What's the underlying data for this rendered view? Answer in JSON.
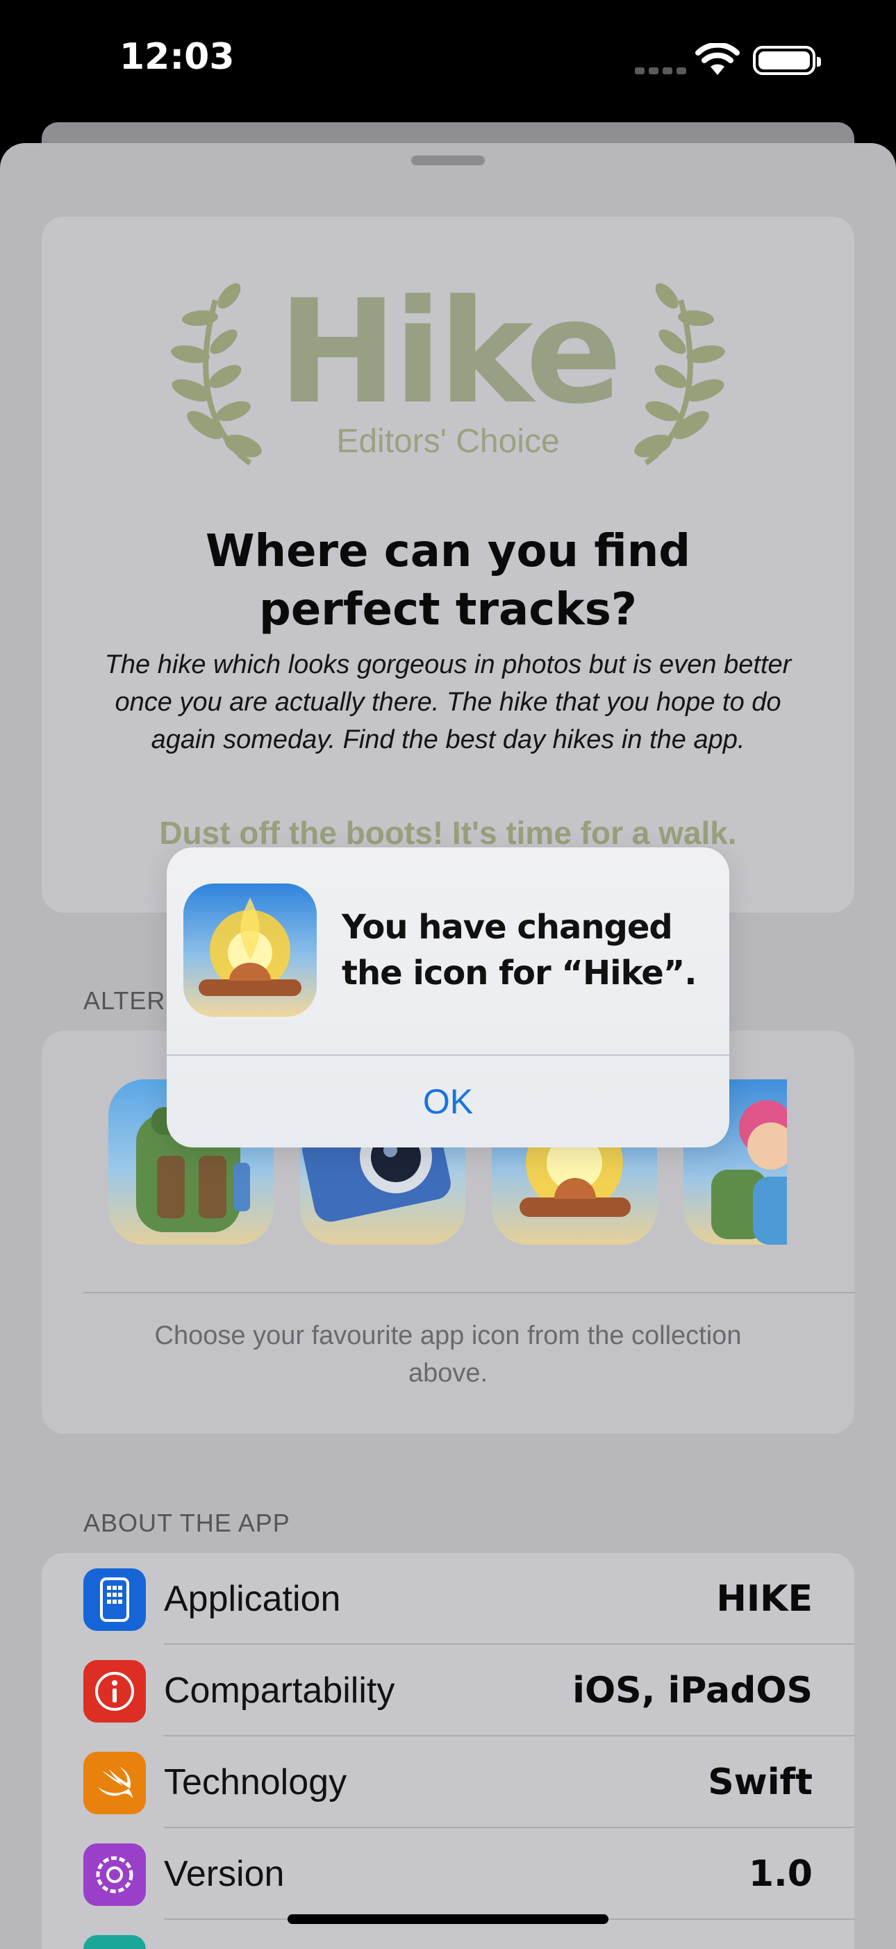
{
  "status": {
    "time": "12:03"
  },
  "hero": {
    "brand": "Hike",
    "badge": "Editors' Choice",
    "question": "Where can you find perfect tracks?",
    "description": "The hike which looks gorgeous in photos but is even better once you are actually there. The hike that you hope to do again someday. Find the best day hikes in the app.",
    "tagline": "Dust off the boots! It's time for a walk."
  },
  "icons_section": {
    "label": "ALTER",
    "icons": [
      "backpack-icon",
      "camera-icon",
      "campfire-icon",
      "hiker-icon"
    ],
    "note": "Choose your favourite app  icon from the collection above."
  },
  "about": {
    "label": "ABOUT THE APP",
    "rows": [
      {
        "label": "Application",
        "value": "HIKE",
        "icon": "apps-icon",
        "color": "#1565d8"
      },
      {
        "label": "Compartability",
        "value": "iOS, iPadOS",
        "icon": "info-icon",
        "color": "#dd2e24"
      },
      {
        "label": "Technology",
        "value": "Swift",
        "icon": "swift-icon",
        "color": "#e8820c"
      },
      {
        "label": "Version",
        "value": "1.0",
        "icon": "gear-icon",
        "color": "#9a3fc9"
      }
    ]
  },
  "alert": {
    "message": "You have changed the icon for “Hike”.",
    "ok": "OK"
  }
}
